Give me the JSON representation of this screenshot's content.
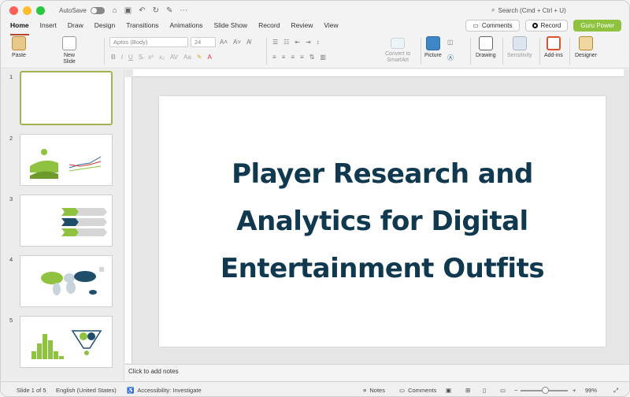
{
  "titlebar": {
    "autosave_label": "AutoSave",
    "search_placeholder": "Search (Cmd + Ctrl + U)"
  },
  "tabs": [
    {
      "label": "Home",
      "active": true
    },
    {
      "label": "Insert"
    },
    {
      "label": "Draw"
    },
    {
      "label": "Design"
    },
    {
      "label": "Transitions"
    },
    {
      "label": "Animations"
    },
    {
      "label": "Slide Show"
    },
    {
      "label": "Record"
    },
    {
      "label": "Review"
    },
    {
      "label": "View"
    }
  ],
  "tab_actions": {
    "comments": "Comments",
    "record": "Record",
    "guru": "Guru Power"
  },
  "ribbon": {
    "paste": "Paste",
    "new_slide": "New\nSlide",
    "font_name": "Aptos (Body)",
    "font_size": "24",
    "convert_smartart": "Convert to\nSmartArt",
    "picture": "Picture",
    "drawing": "Drawing",
    "sensitivity": "Sensitivity",
    "addins": "Add-ins",
    "designer": "Designer"
  },
  "thumbnails": [
    {
      "num": "1"
    },
    {
      "num": "2"
    },
    {
      "num": "3"
    },
    {
      "num": "4"
    },
    {
      "num": "5"
    }
  ],
  "slide": {
    "title": "Player Research and Analytics for Digital Entertainment Outfits"
  },
  "notes_placeholder": "Click to add notes",
  "status": {
    "slide_count": "Slide 1 of 5",
    "language": "English (United States)",
    "accessibility": "Accessibility: Investigate",
    "notes": "Notes",
    "comments": "Comments",
    "zoom": "99%"
  },
  "colors": {
    "title_text": "#10394f",
    "accent_green": "#8fc23f",
    "tab_underline": "#b7472a"
  }
}
